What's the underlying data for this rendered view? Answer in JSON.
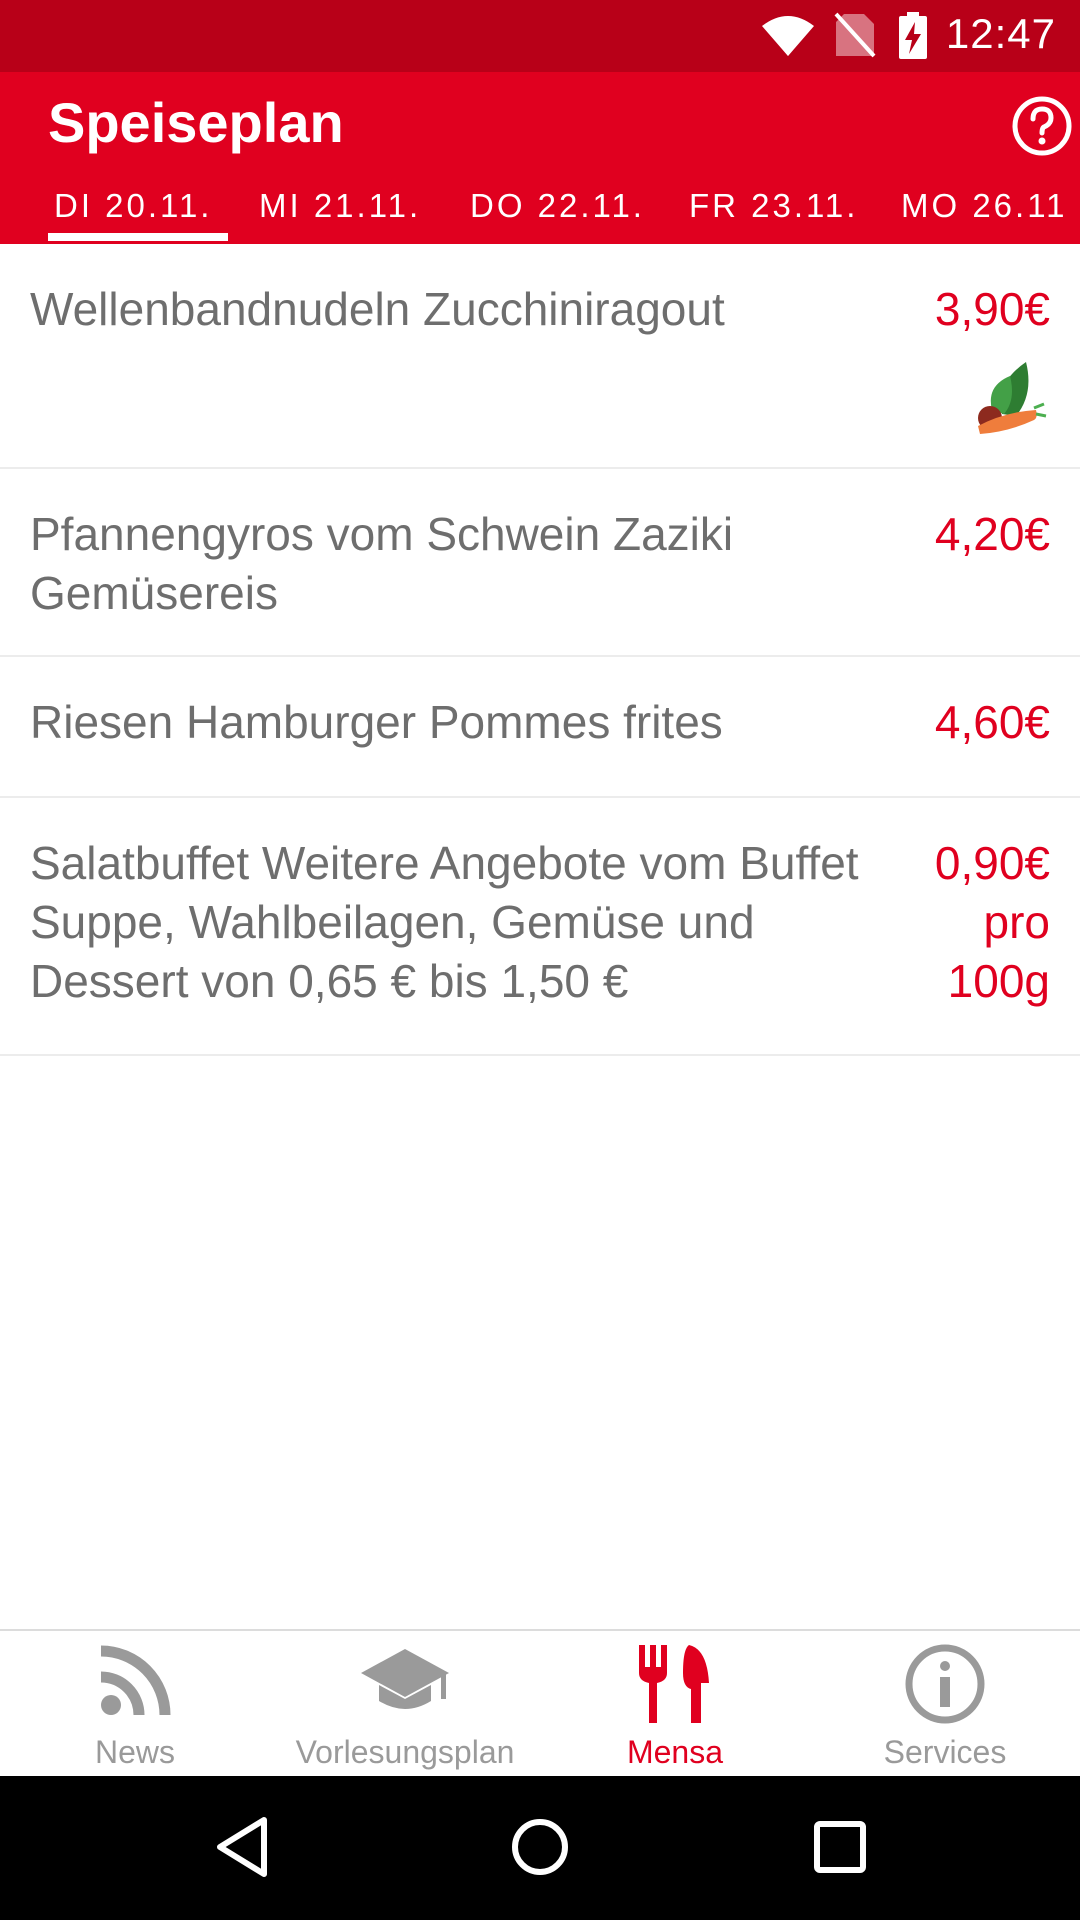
{
  "status_bar": {
    "time": "12:47",
    "icons": [
      "wifi-icon",
      "no-sim-icon",
      "battery-charging-icon"
    ]
  },
  "app_bar": {
    "title": "Speiseplan",
    "help_icon": "help-circle-icon"
  },
  "tabs": [
    {
      "label": "DI 20.11.",
      "active": true
    },
    {
      "label": "MI 21.11.",
      "active": false
    },
    {
      "label": "DO 22.11.",
      "active": false
    },
    {
      "label": "FR 23.11.",
      "active": false
    },
    {
      "label": "MO 26.11",
      "active": false
    }
  ],
  "menu": [
    {
      "dish": "Wellenbandnudeln Zucchiniragout",
      "price": "3,90€",
      "icon": "vegetarian-vegetables-icon"
    },
    {
      "dish": "Pfannengyros vom Schwein Zaziki Gemüsereis",
      "price": "4,20€"
    },
    {
      "dish": "Riesen Hamburger Pommes frites",
      "price": "4,60€"
    },
    {
      "dish": "Salatbuffet Weitere Angebote vom Buffet Suppe, Wahlbeilagen, Gemüse und Dessert von 0,65 € bis 1,50 €",
      "price": "0,90€ pro 100g"
    }
  ],
  "bottom_nav": [
    {
      "label": "News",
      "icon": "rss-icon",
      "active": false
    },
    {
      "label": "Vorlesungsplan",
      "icon": "graduation-cap-icon",
      "active": false
    },
    {
      "label": "Mensa",
      "icon": "fork-knife-icon",
      "active": true
    },
    {
      "label": "Services",
      "icon": "info-icon",
      "active": false
    }
  ],
  "colors": {
    "primary": "#e0001f",
    "status_bar": "#b80018",
    "text_gray": "#6e6e6e",
    "inactive_nav": "#9a9a9a"
  }
}
